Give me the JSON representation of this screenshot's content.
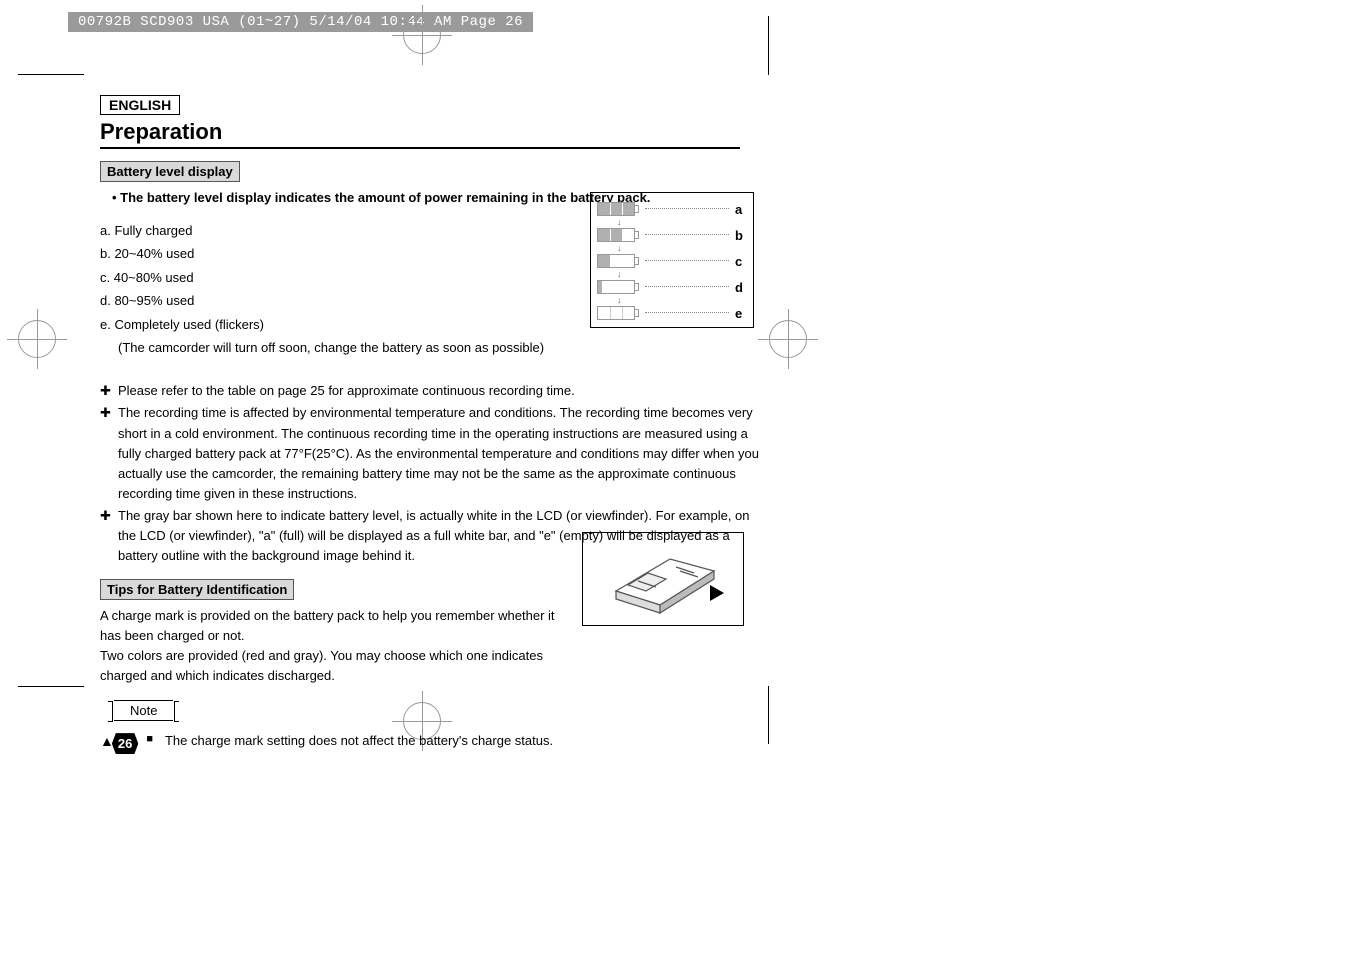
{
  "header_bar": "00792B SCD903 USA (01~27)  5/14/04 10:44 AM  Page 26",
  "language_box": "ENGLISH",
  "section_title": "Preparation",
  "battery_box": "Battery level display",
  "bullet_main": "The battery level display indicates the amount of power remaining in the battery pack.",
  "levels": {
    "a": "a.  Fully charged",
    "b": "b.  20~40% used",
    "c": "c.  40~80% used",
    "d": "d.  80~95% used",
    "e": "e.  Completely used (flickers)",
    "e_sub": "(The camcorder will turn off soon, change the battery as soon as possible)"
  },
  "plus_items": [
    "Please refer to the table on page 25 for approximate continuous recording time.",
    "The recording time is affected by environmental temperature and conditions. The recording time becomes very short in a cold environment. The continuous recording time in the operating instructions are measured using a fully charged battery pack at 77°F(25°C). As the environmental temperature and conditions may differ when you actually use the camcorder, the remaining battery time may not be the same as the approximate continuous recording time given in these instructions.",
    "The gray bar shown here to indicate battery level, is actually white in the LCD (or viewfinder). For example, on the LCD (or viewfinder), \"a\" (full) will be displayed as a full white bar, and \"e\" (empty) will be displayed as a battery outline with the background image behind it."
  ],
  "tips_box": "Tips for Battery Identification",
  "tips_text": "A charge mark is provided on the battery pack to help you remember whether it has been charged or not.\nTwo colors are provided (red and gray). You may choose which one indicates charged and which indicates discharged.",
  "note_label": "Note",
  "note_text": "The charge mark setting does not affect the battery's charge status.",
  "page_number": "26",
  "fig_labels": {
    "a": "a",
    "b": "b",
    "c": "c",
    "d": "d",
    "e": "e"
  }
}
